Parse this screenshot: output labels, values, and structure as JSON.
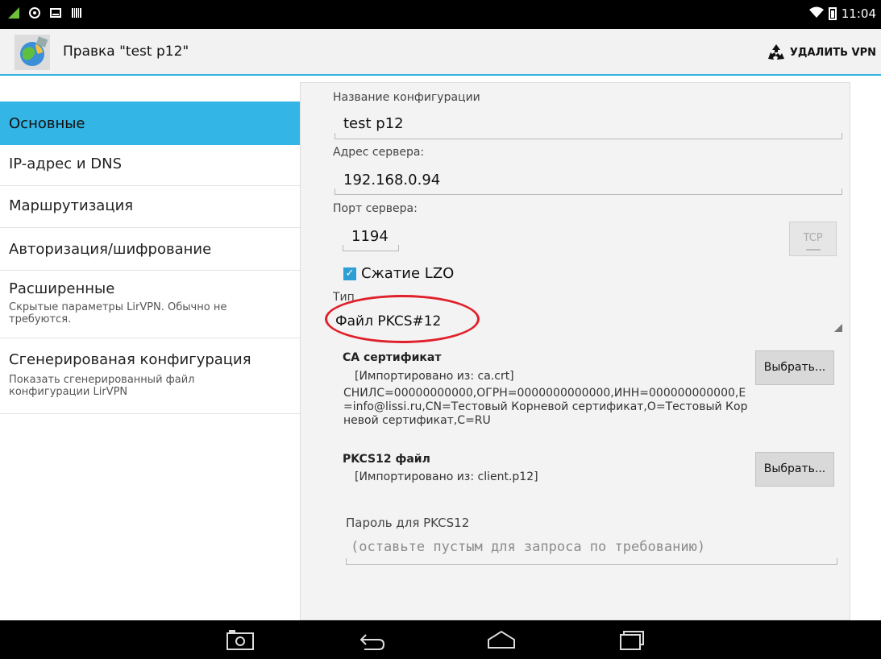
{
  "statusbar": {
    "time": "11:04"
  },
  "actionbar": {
    "title": "Правка \"test p12\"",
    "delete_label": "УДАЛИТЬ VPN"
  },
  "menu": {
    "items": [
      {
        "title": "Основные",
        "subtitle": ""
      },
      {
        "title": "IP-адрес и DNS",
        "subtitle": ""
      },
      {
        "title": "Маршрутизация",
        "subtitle": ""
      },
      {
        "title": "Авторизация/шифрование",
        "subtitle": ""
      },
      {
        "title": "Расширенные",
        "subtitle": "Скрытые параметры LirVPN. Обычно не требуются."
      },
      {
        "title": "Сгенерированая конфигурация",
        "subtitle": "Показать сгенерированный файл конфигурации LirVPN"
      }
    ]
  },
  "form": {
    "config_name_label": "Название конфигурации",
    "config_name_value": "test p12",
    "server_address_label": "Адрес сервера:",
    "server_address_value": "192.168.0.94",
    "server_port_label": "Порт сервера:",
    "server_port_value": "1194",
    "protocol_button": "TCP",
    "lzo_label": "Сжатие LZO",
    "lzo_checked": true,
    "type_label": "Тип",
    "type_value": "Файл PKCS#12",
    "ca_title": "CA сертификат",
    "ca_text": "[Импортировано из: ca.crt]",
    "ca_details": "СНИЛС=00000000000,ОГРН=0000000000000,ИНН=000000000000,E=info@lissi.ru,CN=Тестовый Корневой сертификат,O=Тестовый Корневой сертификат,C=RU",
    "ca_choose": "Выбрать...",
    "pkcs_title": "PKCS12 файл",
    "pkcs_text": "[Импортировано из: client.p12]",
    "pkcs_choose": "Выбрать...",
    "password_label": "Пароль для PKCS12",
    "password_placeholder": "(оставьте пустым для запроса по требованию)"
  },
  "colors": {
    "accent": "#33b5e5",
    "highlight_circle": "#e0202a"
  }
}
